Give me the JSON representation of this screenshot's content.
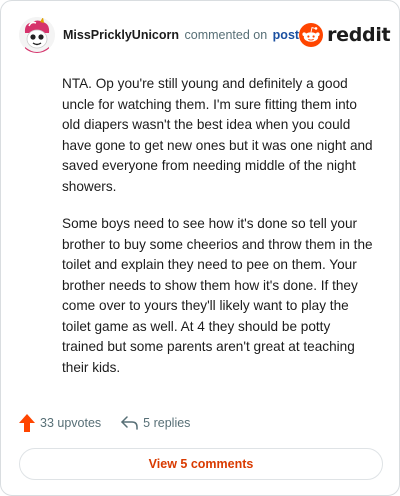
{
  "comment": {
    "username": "MissPricklyUnicorn",
    "commented_text": "commented on",
    "post_link": "post",
    "brand": "reddit",
    "paragraphs": [
      "NTA. Op you're still young and definitely a good uncle for watching them. I'm sure fitting them into old diapers wasn't the best idea when you could have gone to get new ones but it was one night and saved everyone from needing middle of the night showers.",
      "Some boys need to see how it's done so tell your brother to buy some cheerios and throw them in the toilet and explain they need to pee on them. Your brother needs to show them how it's done. If they come over to yours they'll likely want to play the toilet game as well. At 4 they should be potty trained but some parents aren't great at teaching their kids."
    ],
    "upvotes": "33 upvotes",
    "replies": "5 replies",
    "view_comments": "View 5 comments"
  },
  "colors": {
    "upvote": "#ff4500",
    "brand": "#ff4500",
    "view_comments": "#d93a00",
    "post_link": "#1a4fa0"
  },
  "icons": {
    "avatar": "unicorn-avatar-icon",
    "brand": "reddit-snoo-icon",
    "upvote": "upvote-arrow-icon",
    "reply": "reply-arrow-icon"
  }
}
